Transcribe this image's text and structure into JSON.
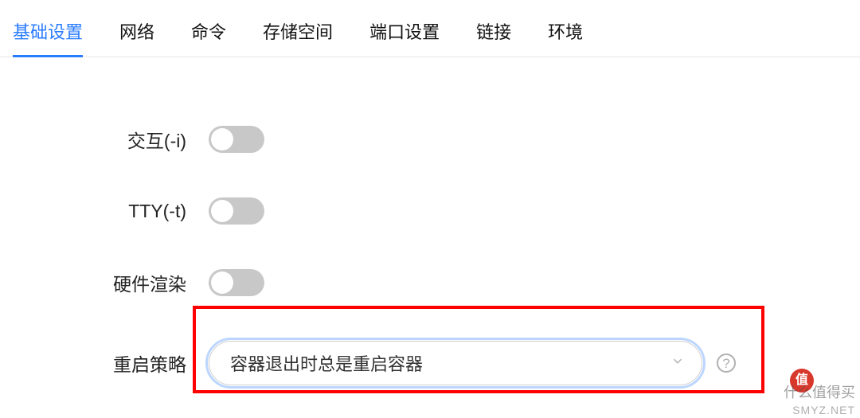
{
  "tabs": {
    "items": [
      {
        "label": "基础设置",
        "name": "tab-basic-settings",
        "active": true
      },
      {
        "label": "网络",
        "name": "tab-network",
        "active": false
      },
      {
        "label": "命令",
        "name": "tab-command",
        "active": false
      },
      {
        "label": "存储空间",
        "name": "tab-storage",
        "active": false
      },
      {
        "label": "端口设置",
        "name": "tab-port-settings",
        "active": false
      },
      {
        "label": "链接",
        "name": "tab-links",
        "active": false
      },
      {
        "label": "环境",
        "name": "tab-environment",
        "active": false
      }
    ]
  },
  "form": {
    "interactive": {
      "label": "交互(-i)",
      "value": false
    },
    "tty": {
      "label": "TTY(-t)",
      "value": false
    },
    "hw_render": {
      "label": "硬件渲染",
      "value": false
    },
    "restart_policy": {
      "label": "重启策略",
      "selected": "容器退出时总是重启容器"
    }
  },
  "watermark": {
    "site": "SMYZ.NET",
    "brand_text": "什么值得买",
    "brand_badge": "值"
  }
}
